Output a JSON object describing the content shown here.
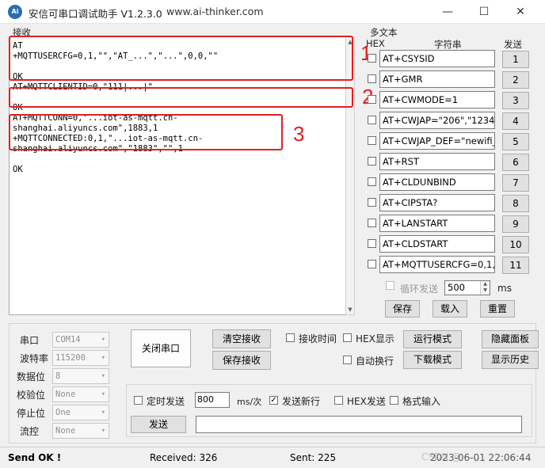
{
  "window": {
    "title": "安信可串口调试助手 V1.2.3.0",
    "url": "www.ai-thinker.com",
    "icon_text": "Ai",
    "minimize_glyph": "—",
    "maximize_glyph": "☐",
    "close_glyph": "✕"
  },
  "receive": {
    "label": "接收",
    "lines": "AT\n+MQTTUSERCFG=0,1,\"\",\"AT_...\",\"...\",0,0,\"\"\n\nOK\nAT+MQTTCLIENTID=0,\"111|...|\"\n\nOK\nAT+MQTTCONN=0,\"...iot-as-mqtt.cn-\nshanghai.aliyuncs.com\",1883,1\n+MQTTCONNECTED:0,1,\"...iot-as-mqtt.cn-\nshanghai.aliyuncs.com\",\"1883\",\"\",1\n\nOK"
  },
  "annotations": {
    "n1": "1",
    "n2": "2",
    "n3": "3"
  },
  "multitext": {
    "label": "多文本",
    "col_hex": "HEX",
    "col_string": "字符串",
    "col_send": "发送",
    "rows": [
      {
        "text": "AT+CSYSID",
        "btn": "1"
      },
      {
        "text": "AT+GMR",
        "btn": "2"
      },
      {
        "text": "AT+CWMODE=1",
        "btn": "3"
      },
      {
        "text": "AT+CWJAP=\"206\",\"123456",
        "btn": "4"
      },
      {
        "text": "AT+CWJAP_DEF=\"newifi_",
        "btn": "5"
      },
      {
        "text": "AT+RST",
        "btn": "6"
      },
      {
        "text": "AT+CLDUNBIND",
        "btn": "7"
      },
      {
        "text": "AT+CIPSTA?",
        "btn": "8"
      },
      {
        "text": "AT+LANSTART",
        "btn": "9"
      },
      {
        "text": "AT+CLDSTART",
        "btn": "10"
      },
      {
        "text": "AT+MQTTUSERCFG=0,1,\"",
        "btn": "11"
      }
    ],
    "loop_label": "循环发送",
    "loop_value": "500",
    "loop_unit": "ms",
    "save": "保存",
    "load": "载入",
    "reset": "重置"
  },
  "serial": {
    "port_label": "串口",
    "port_value": "COM14",
    "baud_label": "波特率",
    "baud_value": "115200",
    "data_label": "数据位",
    "data_value": "8",
    "parity_label": "校验位",
    "parity_value": "None",
    "stop_label": "停止位",
    "stop_value": "One",
    "flow_label": "流控",
    "flow_value": "None"
  },
  "controls": {
    "close_port": "关闭串口",
    "clear_recv": "清空接收",
    "save_recv": "保存接收",
    "recv_time": "接收时间",
    "hex_display": "HEX显示",
    "auto_newline": "自动换行",
    "run_mode": "运行模式",
    "download_mode": "下载模式",
    "hide_panel": "隐藏面板",
    "show_history": "显示历史"
  },
  "send": {
    "timed_send": "定时发送",
    "interval_value": "800",
    "interval_unit": "ms/次",
    "send_newline": "发送新行",
    "hex_send": "HEX发送",
    "format_input": "格式输入",
    "send_button": "发送",
    "input_value": ""
  },
  "status": {
    "send_ok": "Send OK !",
    "received": "Received: 326",
    "sent": "Sent: 225",
    "datetime": "2023-06-01 22:06:44",
    "watermark": "CSDN @..."
  }
}
